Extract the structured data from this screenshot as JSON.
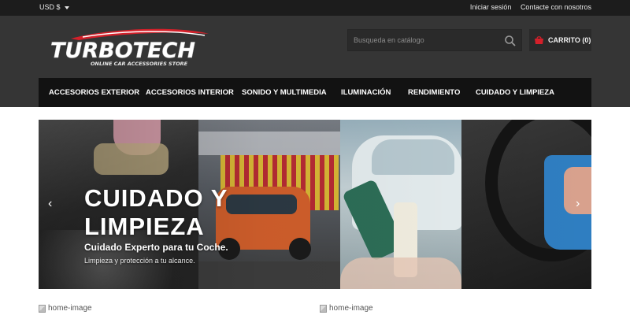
{
  "topbar": {
    "currency": "USD $",
    "login": "Iniciar sesión",
    "contact": "Contacte con nosotros"
  },
  "header": {
    "logo_text": "TURBOTECH",
    "logo_tagline": "ONLINE CAR ACCESSORIES STORE",
    "search_placeholder": "Busqueda en catálogo",
    "cart_label": "CARRITO (0)"
  },
  "nav": {
    "items": [
      {
        "label": "ACCESORIOS EXTERIOR"
      },
      {
        "label": "ACCESORIOS INTERIOR"
      },
      {
        "label": "SONIDO Y MULTIMEDIA"
      },
      {
        "label": "ILUMINACIÓN"
      },
      {
        "label": "RENDIMIENTO"
      },
      {
        "label": "CUIDADO Y LIMPIEZA"
      }
    ]
  },
  "slider": {
    "title_line1": "CUIDADO Y",
    "title_line2": "LIMPIEZA",
    "subtitle": "Cuidado Experto para tu Coche.",
    "description": "Limpieza y protección a tu alcance.",
    "prev_icon": "chevron-left-icon",
    "next_icon": "chevron-right-icon"
  },
  "home_images": [
    {
      "alt": "home-image"
    },
    {
      "alt": "home-image"
    }
  ],
  "colors": {
    "topbar_bg": "#1c1c1c",
    "header_bg": "#353535",
    "nav_bg": "#121212",
    "accent_red": "#d4202a"
  }
}
